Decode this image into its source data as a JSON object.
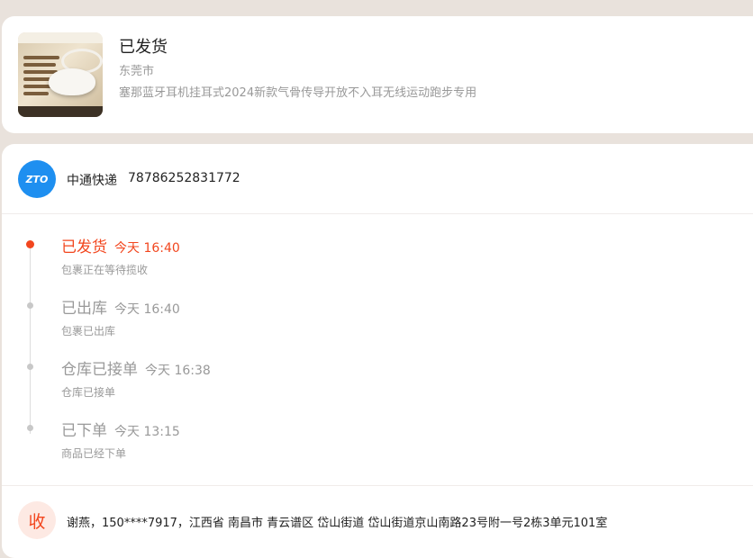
{
  "order": {
    "status": "已发货",
    "city": "东莞市",
    "product": "塞那蓝牙耳机挂耳式2024新款气骨传导开放不入耳无线运动跑步专用"
  },
  "carrier": {
    "logo_text": "ZTO",
    "name": "中通快递",
    "tracking_number": "78786252831772"
  },
  "timeline": [
    {
      "title": "已发货",
      "time": "今天 16:40",
      "desc": "包裹正在等待揽收",
      "active": true
    },
    {
      "title": "已出库",
      "time": "今天 16:40",
      "desc": "包裹已出库",
      "active": false
    },
    {
      "title": "仓库已接单",
      "time": "今天 16:38",
      "desc": "仓库已接单",
      "active": false
    },
    {
      "title": "已下单",
      "time": "今天 13:15",
      "desc": "商品已经下单",
      "active": false
    }
  ],
  "receiver": {
    "icon_label": "收",
    "info": "谢燕，150****7917，江西省 南昌市 青云谱区 岱山街道 岱山街道京山南路23号附一号2栋3单元101室"
  },
  "colors": {
    "accent": "#f2461e",
    "carrier_blue": "#1e8ff0",
    "background": "#e9e2dc"
  }
}
